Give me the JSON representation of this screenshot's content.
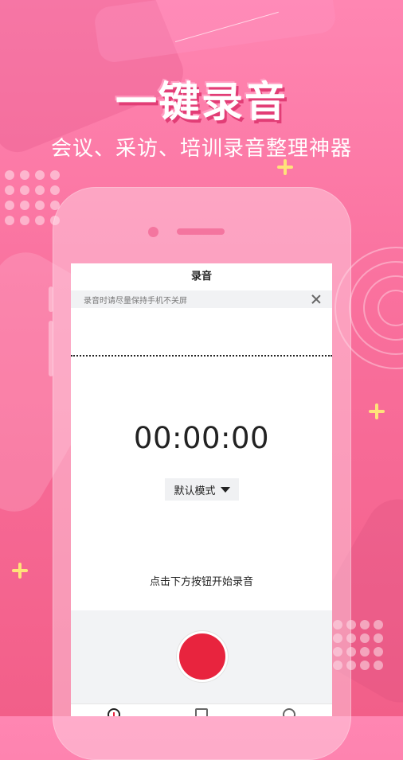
{
  "promo": {
    "headline": "一键录音",
    "subheadline": "会议、采访、培训录音整理神器"
  },
  "app": {
    "title": "录音",
    "notice_text": "录音时请尽量保持手机不关屏",
    "timer": "00:00:00",
    "mode_label": "默认模式",
    "hint": "点击下方按钮开始录音",
    "tabs": [
      "record-icon",
      "file-icon",
      "profile-icon"
    ]
  },
  "colors": {
    "background_top": "#ff86b2",
    "background_bottom": "#f25f89",
    "record_button": "#e8243e",
    "sparkle": "#ffe27a"
  }
}
